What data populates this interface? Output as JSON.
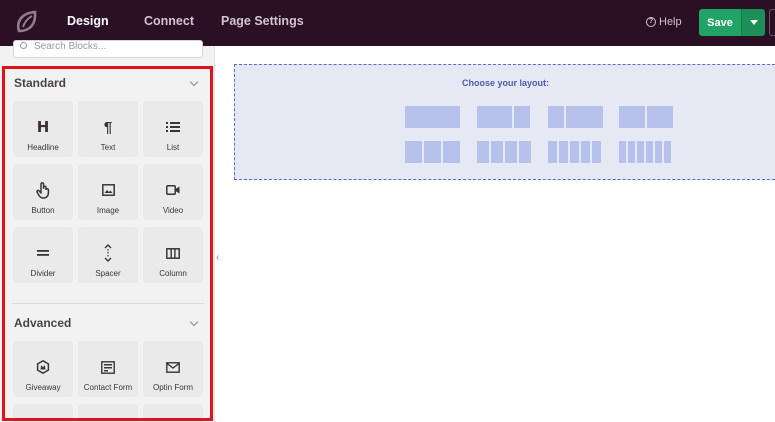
{
  "topbar": {
    "tabs": [
      {
        "label": "Design",
        "active": true
      },
      {
        "label": "Connect",
        "active": false
      },
      {
        "label": "Page Settings",
        "active": false
      }
    ],
    "help_label": "Help",
    "save_label": "Save",
    "colors": {
      "bar": "#2b0f24",
      "save": "#21a366"
    }
  },
  "sidebar": {
    "search_placeholder": "Search Blocks...",
    "standard": {
      "title": "Standard",
      "blocks": [
        {
          "label": "Headline",
          "icon": "headline-icon"
        },
        {
          "label": "Text",
          "icon": "paragraph-icon"
        },
        {
          "label": "List",
          "icon": "list-icon"
        },
        {
          "label": "Button",
          "icon": "pointer-hand-icon"
        },
        {
          "label": "Image",
          "icon": "image-icon"
        },
        {
          "label": "Video",
          "icon": "video-camera-icon"
        },
        {
          "label": "Divider",
          "icon": "divider-icon"
        },
        {
          "label": "Spacer",
          "icon": "spacer-icon"
        },
        {
          "label": "Column",
          "icon": "columns-icon"
        }
      ]
    },
    "advanced": {
      "title": "Advanced",
      "blocks": [
        {
          "label": "Giveaway",
          "icon": "giveaway-badge-icon"
        },
        {
          "label": "Contact Form",
          "icon": "contact-form-icon"
        },
        {
          "label": "Optin Form",
          "icon": "envelope-icon"
        }
      ]
    },
    "highlight_color": "#e1121b"
  },
  "canvas": {
    "layout_title": "Choose your layout:"
  }
}
